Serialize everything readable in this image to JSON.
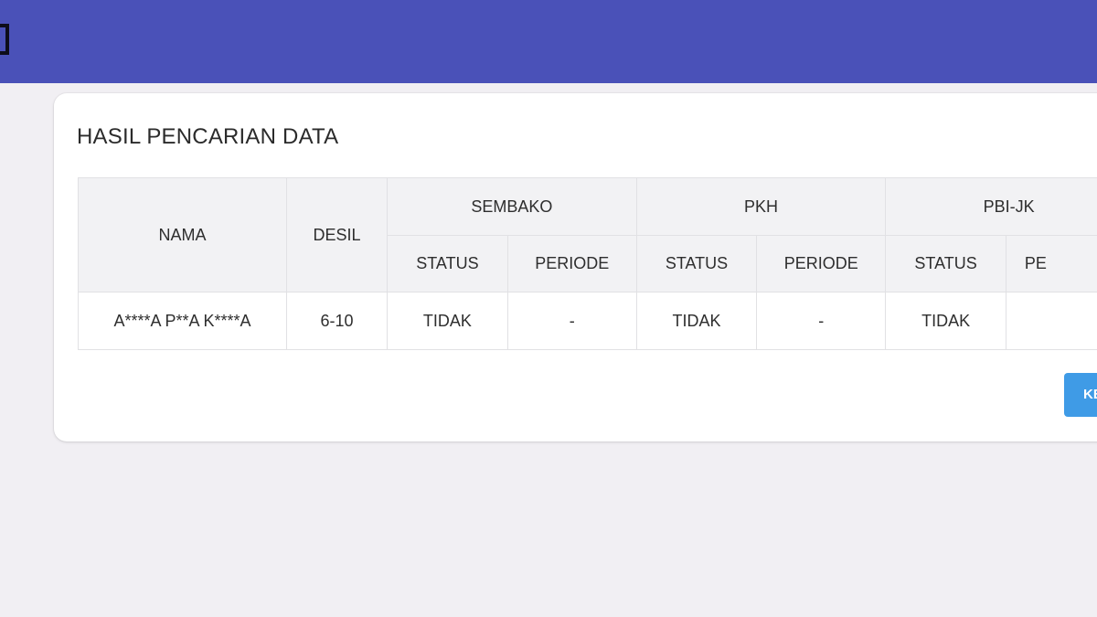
{
  "card": {
    "title": "HASIL PENCARIAN DATA"
  },
  "table": {
    "headers": {
      "nama": "NAMA",
      "desil": "DESIL",
      "groups": [
        "SEMBAKO",
        "PKH",
        "PBI-JK"
      ],
      "sub": [
        "STATUS",
        "PERIODE",
        "STATUS",
        "PERIODE",
        "STATUS",
        "PE"
      ]
    },
    "rows": [
      {
        "nama": "A****A P**A K****A",
        "desil": "6-10",
        "cells": [
          "TIDAK",
          "-",
          "TIDAK",
          "-",
          "TIDAK",
          ""
        ]
      }
    ]
  },
  "action_button": {
    "label": "KE"
  },
  "colors": {
    "topbar": "#4a51b8",
    "button": "#3f9be6",
    "background": "#f1eff3"
  }
}
